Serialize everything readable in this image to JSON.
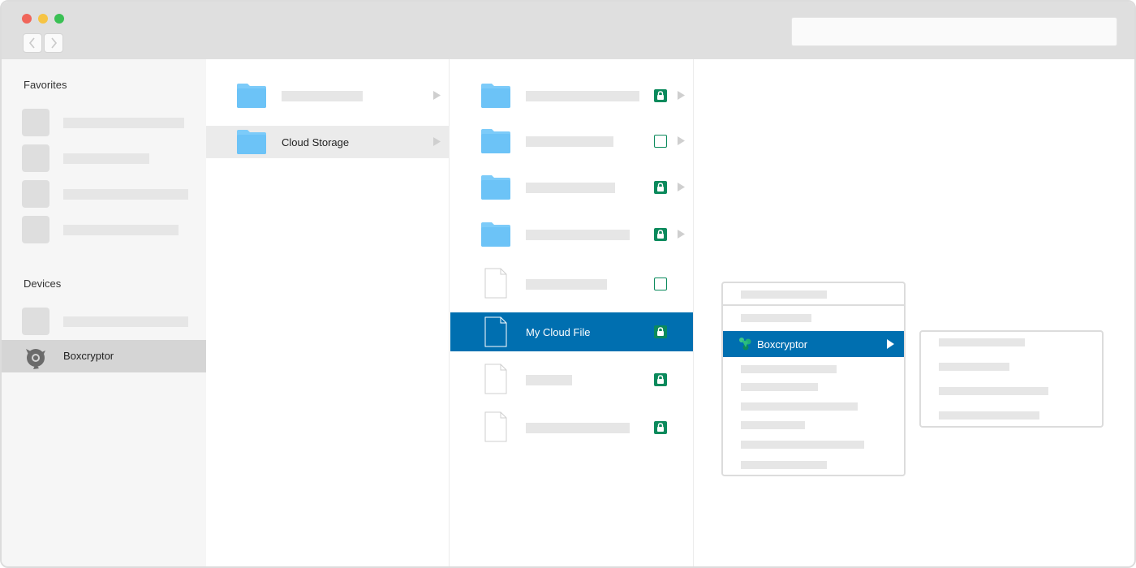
{
  "window": {
    "accent": "#006fb0",
    "lock_color": "#0b8a5c",
    "folder_color": "#7ccbf9"
  },
  "toolbar": {
    "back_icon": "chevron-left-icon",
    "forward_icon": "chevron-right-icon",
    "search_placeholder": ""
  },
  "sidebar": {
    "favorites_title": "Favorites",
    "devices_title": "Devices",
    "selected_device": "Boxcryptor"
  },
  "column1": {
    "selected_folder": "Cloud Storage"
  },
  "column2": {
    "selected_file": "My Cloud File",
    "items": [
      {
        "kind": "folder",
        "status": "encrypted"
      },
      {
        "kind": "folder",
        "status": "unencrypted"
      },
      {
        "kind": "folder",
        "status": "encrypted"
      },
      {
        "kind": "folder",
        "status": "encrypted"
      },
      {
        "kind": "file",
        "status": "unencrypted"
      },
      {
        "kind": "file",
        "status": "encrypted",
        "selected": true
      },
      {
        "kind": "file",
        "status": "encrypted"
      },
      {
        "kind": "file",
        "status": "encrypted"
      }
    ]
  },
  "context_menu": {
    "boxcryptor_label": "Boxcryptor",
    "boxcryptor_icon": "boxcryptor-logo-icon"
  }
}
